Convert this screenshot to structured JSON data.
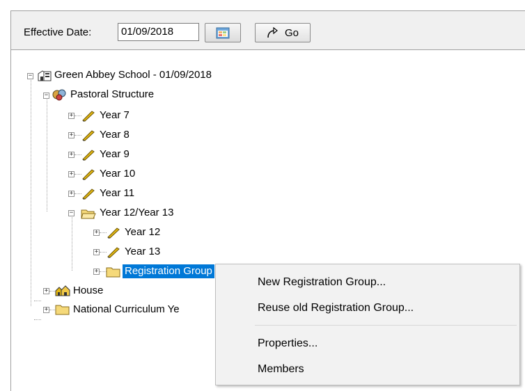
{
  "toolbar": {
    "effective_date_label": "Effective Date:",
    "effective_date_value": "01/09/2018",
    "calendar_icon": "calendar-icon",
    "go_label": "Go",
    "go_icon": "redo-arrow-icon"
  },
  "tree": {
    "root": {
      "label": "Green Abbey School - 01/09/2018",
      "icon": "school-icon",
      "expanded": true
    },
    "pastoral": {
      "label": "Pastoral Structure",
      "icon": "pastoral-icon",
      "expanded": true
    },
    "years": [
      {
        "label": "Year  7",
        "icon": "pencil-icon"
      },
      {
        "label": "Year  8",
        "icon": "pencil-icon"
      },
      {
        "label": "Year  9",
        "icon": "pencil-icon"
      },
      {
        "label": "Year 10",
        "icon": "pencil-icon"
      },
      {
        "label": "Year 11",
        "icon": "pencil-icon"
      }
    ],
    "sixth_form": {
      "label": "Year 12/Year 13",
      "icon": "open-folder-icon",
      "expanded": true,
      "children": [
        {
          "label": "Year 12",
          "icon": "pencil-icon"
        },
        {
          "label": "Year 13",
          "icon": "pencil-icon"
        },
        {
          "label": "Registration Group",
          "icon": "folder-icon",
          "selected": true
        }
      ]
    },
    "house": {
      "label": "House",
      "icon": "houses-icon"
    },
    "national_curriculum": {
      "label": "National Curriculum Ye",
      "icon": "folder-icon"
    }
  },
  "context_menu": {
    "items": [
      {
        "label": "New Registration Group..."
      },
      {
        "label": "Reuse old Registration Group..."
      },
      {
        "label": "Properties..."
      },
      {
        "label": "Members"
      }
    ]
  },
  "colors": {
    "selection": "#0078d7",
    "pencil": "#e2b714",
    "folder": "#f5d97a"
  }
}
